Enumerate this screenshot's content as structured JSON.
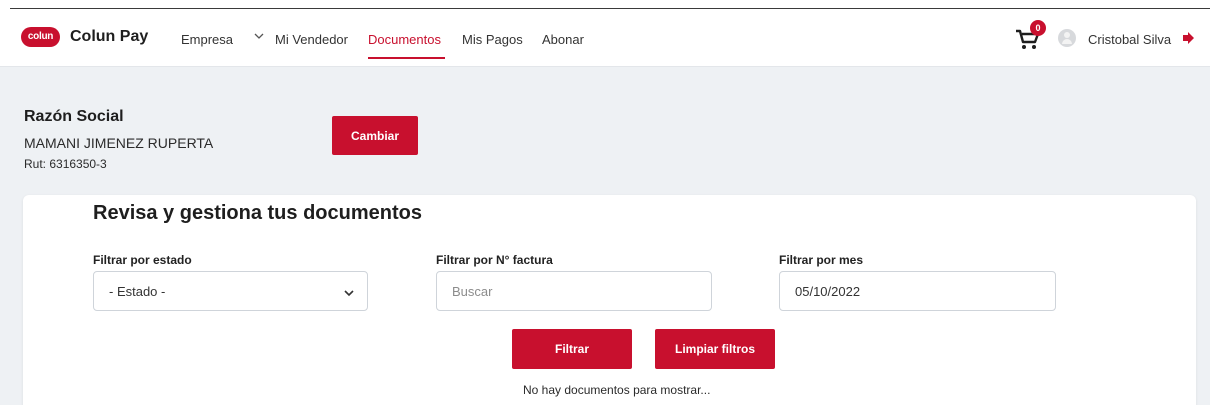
{
  "brand": {
    "logo_text": "colun",
    "name": "Colun Pay",
    "accent_color": "#c8102e"
  },
  "nav": {
    "items": [
      {
        "label": "Empresa",
        "has_dropdown": true,
        "icon": "chevron-down-icon"
      },
      {
        "label": "Mi Vendedor"
      },
      {
        "label": "Documentos",
        "active": true
      },
      {
        "label": "Mis Pagos"
      },
      {
        "label": "Abonar"
      }
    ]
  },
  "header_right": {
    "cart_icon": "cart-icon",
    "cart_count": "0",
    "avatar_icon": "user-avatar-icon",
    "user_name": "Cristobal Silva",
    "logout_icon": "logout-icon"
  },
  "company": {
    "title": "Razón Social",
    "name": "MAMANI JIMENEZ RUPERTA",
    "rut": "Rut: 6316350-3",
    "change_button": "Cambiar"
  },
  "documents": {
    "title": "Revisa y gestiona tus documentos",
    "filters": {
      "estado": {
        "label": "Filtrar por estado",
        "selected": "- Estado -"
      },
      "factura": {
        "label": "Filtrar por N° factura",
        "placeholder": "Buscar",
        "value": ""
      },
      "mes": {
        "label": "Filtrar por mes",
        "value": "05/10/2022"
      }
    },
    "filter_button": "Filtrar",
    "clear_button": "Limpiar filtros",
    "empty_message": "No hay documentos para mostrar..."
  }
}
